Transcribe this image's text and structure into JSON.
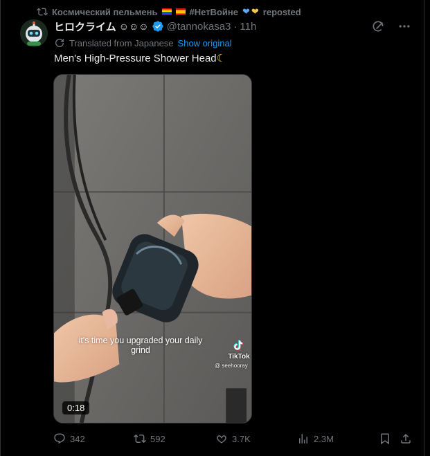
{
  "repost": {
    "user": "Космический пельмень",
    "hashtag": "#НетВойне",
    "suffix": "reposted"
  },
  "author": {
    "display_name": "ヒロクライム",
    "handle": "@tannokasa3",
    "separator": "·",
    "time": "11h"
  },
  "translation": {
    "note": "Translated from Japanese",
    "show_original": "Show original"
  },
  "tweet": {
    "text": "Men's High-Pressure Shower Head"
  },
  "media": {
    "caption": "it's time you upgraded your daily grind",
    "watermark": "TikTok",
    "watermark_user": "@ seehooray",
    "duration": "0:18"
  },
  "actions": {
    "replies": "342",
    "reposts": "592",
    "likes": "3.7K",
    "views": "2.3M"
  },
  "colors": {
    "background": "#000000",
    "text": "#e7e9ea",
    "muted": "#71767b",
    "accent": "#1d9bf0",
    "border": "#2f3336"
  },
  "icons": [
    "repost-icon",
    "verified-badge-icon",
    "grok-icon",
    "more-icon",
    "translate-icon",
    "reply-icon",
    "like-icon",
    "views-icon",
    "bookmark-icon",
    "share-icon"
  ]
}
